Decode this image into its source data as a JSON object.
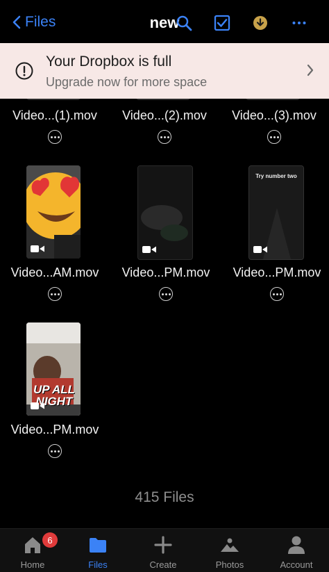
{
  "header": {
    "back_label": "Files",
    "title": "new",
    "icons": [
      "search-icon",
      "select-checkbox-icon",
      "download-icon",
      "more-icon"
    ],
    "accent_color": "#3b82f6"
  },
  "banner": {
    "title": "Your Dropbox is full",
    "subtitle": "Upgrade now for more space"
  },
  "files": [
    {
      "name": "Video...(1).mov"
    },
    {
      "name": "Video...(2).mov"
    },
    {
      "name": "Video...(3).mov"
    },
    {
      "name": "Video...AM.mov",
      "thumbnail": "heart-eyes-emoji"
    },
    {
      "name": "Video...PM.mov",
      "thumbnail": "dark-video"
    },
    {
      "name": "Video...PM.mov",
      "thumbnail": "dark-video-with-caption",
      "caption": "Try number two"
    },
    {
      "name": "Video...PM.mov",
      "thumbnail": "photo-with-sticker",
      "caption": "UP ALL NIGHT"
    }
  ],
  "file_count": "415 Files",
  "tabbar": {
    "items": [
      {
        "label": "Home",
        "icon": "home-icon",
        "badge": "6"
      },
      {
        "label": "Files",
        "icon": "folder-icon",
        "active": true
      },
      {
        "label": "Create",
        "icon": "plus-icon"
      },
      {
        "label": "Photos",
        "icon": "photos-icon"
      },
      {
        "label": "Account",
        "icon": "account-icon"
      }
    ]
  }
}
